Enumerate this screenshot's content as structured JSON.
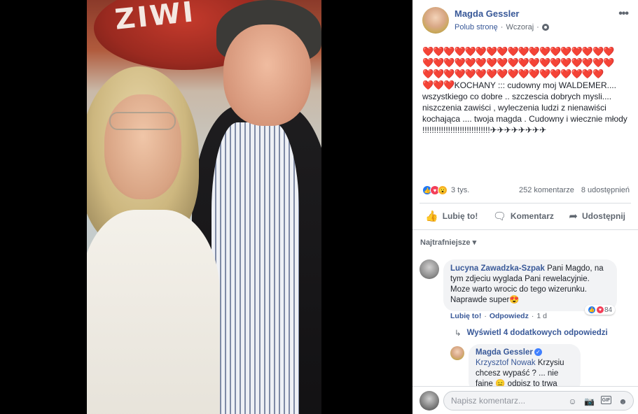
{
  "post": {
    "author": "Magda Gessler",
    "like_page": "Polub stronę",
    "separator": "·",
    "time": "Wczoraj",
    "more": "•••",
    "hearts_line1": "❤️❤️❤️❤️❤️❤️❤️❤️❤️❤️❤️❤️❤️❤️❤️❤️❤️❤️",
    "hearts_line2": "❤️❤️❤️❤️❤️❤️❤️❤️❤️❤️❤️❤️❤️❤️❤️❤️❤️❤️",
    "hearts_line3": "❤️❤️❤️❤️❤️❤️❤️❤️❤️❤️❤️❤️❤️❤️❤️❤️❤️",
    "hearts_line4": "❤️❤️❤️",
    "text": "KOCHANY ::: cudowny moj WALDEMER.... wszystkiego co dobre .. szczescia dobrych mysli.... niszczenia zawiści , wyleczenia ludzi z nienawiści kochająca .... twoja magda . Cudowny i wiecznie młody !!!!!!!!!!!!!!!!!!!!!!!!!!!!!",
    "planes": "✈✈✈✈✈✈✈✈"
  },
  "reactions": {
    "count": "3 tys.",
    "comments": "252 komentarze",
    "shares": "8 udostępnień"
  },
  "actions": {
    "like": "Lubię to!",
    "comment": "Komentarz",
    "share": "Udostępnij"
  },
  "sort": "Najtrafniejsze",
  "comment1": {
    "author": "Lucyna Zawadzka-Szpak",
    "text": "Pani Magdo, na tym zdjeciu wyglada Pani rewelacyjnie. Moze warto wrocic do tego wizerunku. Naprawde super",
    "emoji": "😍",
    "react_count": "84",
    "like": "Lubię to!",
    "dot": "·",
    "reply": "Odpowiedz",
    "time": "1 d"
  },
  "more_replies": "Wyświetl 4 dodatkowych odpowiedzi",
  "reply1": {
    "author": "Magda Gessler",
    "mention": "Krzysztof Nowak",
    "text": "Krzysiu chcesz wypaść ? ... nie fajne",
    "emoji": "😑",
    "text2": "odpisz to trwa"
  },
  "composer": {
    "placeholder": "Napisz komentarz..."
  },
  "colors": {
    "link": "#385898",
    "heart": "#e02020"
  }
}
